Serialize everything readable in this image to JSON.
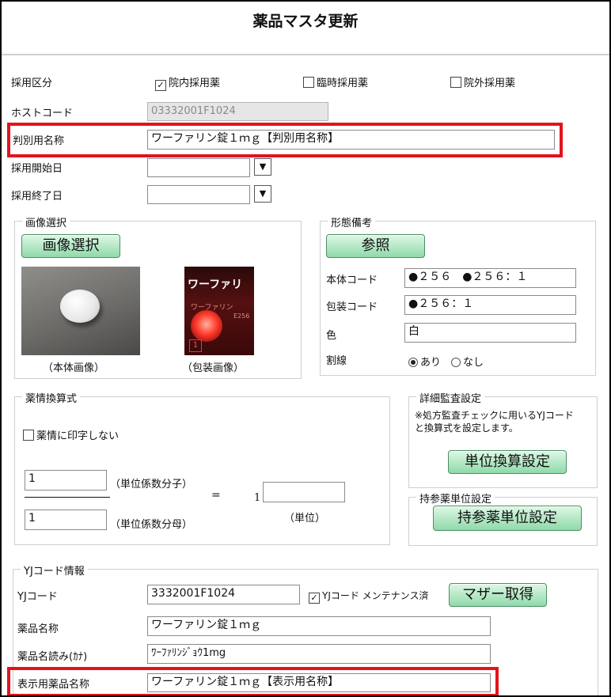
{
  "title": "薬品マスタ更新",
  "adoption": {
    "label": "採用区分",
    "options": [
      {
        "label": "院内採用薬",
        "checked": true
      },
      {
        "label": "臨時採用薬",
        "checked": false
      },
      {
        "label": "院外採用薬",
        "checked": false
      }
    ]
  },
  "host_code": {
    "label": "ホストコード",
    "value": "03332001F1024"
  },
  "id_name": {
    "label": "判別用名称",
    "value": "ワーファリン錠１ｍｇ【判別用名称】"
  },
  "start_date": {
    "label": "採用開始日",
    "value": ""
  },
  "end_date": {
    "label": "採用終了日",
    "value": ""
  },
  "dropdown_glyph": "▼",
  "image_select": {
    "legend": "画像選択",
    "button": "画像選択",
    "captions": [
      "（本体画像）",
      "（包装画像）"
    ],
    "package_text": [
      "ワーファリ",
      "ワーファリン",
      "E256",
      "1"
    ]
  },
  "form_notes": {
    "legend": "形態備考",
    "button": "参照",
    "body_code": {
      "label": "本体コード",
      "value": "●２５６　●２５６：１"
    },
    "package_code": {
      "label": "包装コード",
      "value": "●２５６：１"
    },
    "color": {
      "label": "色",
      "value": "白"
    },
    "score_line": {
      "label": "割線",
      "options": [
        {
          "label": "あり",
          "selected": true
        },
        {
          "label": "なし",
          "selected": false
        }
      ]
    }
  },
  "conversion": {
    "legend": "薬情換算式",
    "no_print": {
      "label": "薬情に印字しない",
      "checked": false
    },
    "numerator": {
      "value": "1",
      "label": "（単位係数分子）"
    },
    "denominator": {
      "value": "1",
      "label": "（単位係数分母）"
    },
    "equals": "=",
    "one": "1",
    "unit": {
      "value": "",
      "label": "（単位）"
    }
  },
  "detail_audit": {
    "legend": "詳細監査設定",
    "note_line1": "※処方監査チェックに用いるYJコード",
    "note_line2": "と換算式を設定します。",
    "button": "単位換算設定"
  },
  "carry_unit": {
    "legend": "持参薬単位設定",
    "button": "持参薬単位設定"
  },
  "yj_info": {
    "legend": "YJコード情報",
    "yj_code": {
      "label": "YJコード",
      "value": "3332001F1024"
    },
    "maintenance": {
      "label": "YJコード メンテナンス済",
      "checked": true
    },
    "mother_button": "マザー取得",
    "drug_name": {
      "label": "薬品名称",
      "value": "ワーファリン錠１ｍｇ"
    },
    "drug_kana": {
      "label": "薬品名読み(ｶﾅ)",
      "value": "ﾜｰﾌｧﾘﾝｼﾞｮｳ1mg"
    },
    "display_name": {
      "label": "表示用薬品名称",
      "value": "ワーファリン錠１ｍｇ【表示用名称】"
    }
  },
  "colors": {
    "highlight": "#e3131c",
    "button_green": "#8fdaa9"
  }
}
